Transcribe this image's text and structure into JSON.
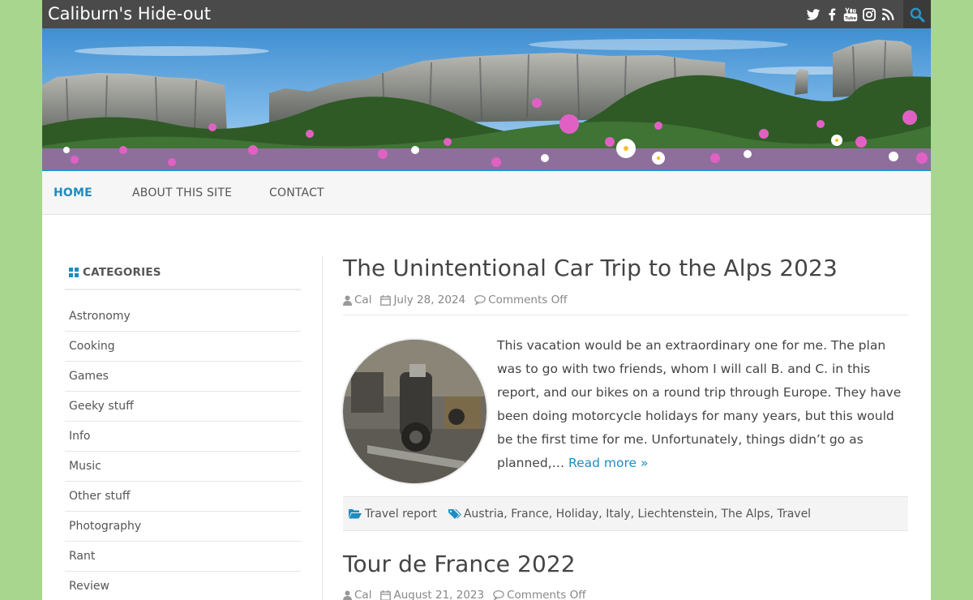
{
  "site": {
    "title": "Caliburn's Hide-out"
  },
  "social": [
    "twitter-icon",
    "facebook-icon",
    "youtube-icon",
    "instagram-icon",
    "rss-icon"
  ],
  "colors": {
    "background": "#a8d68f",
    "accent": "#1e8cc1",
    "topbar": "#4a4a4a"
  },
  "nav": {
    "home": "HOME",
    "about": "ABOUT THIS SITE",
    "contact": "CONTACT"
  },
  "sidebar": {
    "title": "CATEGORIES",
    "items": [
      "Astronomy",
      "Cooking",
      "Games",
      "Geeky stuff",
      "Info",
      "Music",
      "Other stuff",
      "Photography",
      "Rant",
      "Review"
    ]
  },
  "posts": [
    {
      "title": "The Unintentional Car Trip to the Alps 2023",
      "author": "Cal",
      "date": "July 28, 2024",
      "comments": "Comments Off",
      "excerpt": "This vacation would be an extraordinary one for me. The plan was to go with two friends, whom I will call B. and C. in this report, and our bikes on a round trip through Europe. They have been doing motorcycle holidays for many years, but this would be the first time for me. Unfortunately, things didn’t go as planned,…",
      "read_more": "Read more »",
      "category": "Travel report",
      "tags": [
        "Austria",
        "France",
        "Holiday",
        "Italy",
        "Liechtenstein",
        "The Alps",
        "Travel"
      ]
    },
    {
      "title": "Tour de France 2022",
      "author": "Cal",
      "date": "August 21, 2023",
      "comments": "Comments Off"
    }
  ]
}
